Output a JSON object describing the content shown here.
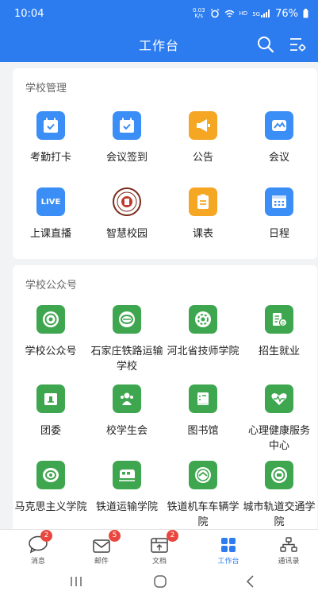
{
  "status": {
    "time": "10:04",
    "speed_value": "0.03",
    "speed_unit": "K/s",
    "hd": "HD",
    "signal": "5G",
    "battery": "76%"
  },
  "header": {
    "title": "工作台"
  },
  "school_management": {
    "title": "学校管理",
    "apps": [
      {
        "label": "考勤打卡",
        "icon": "calendar-check-icon"
      },
      {
        "label": "会议签到",
        "icon": "calendar-check-icon"
      },
      {
        "label": "公告",
        "icon": "megaphone-icon"
      },
      {
        "label": "会议",
        "icon": "meeting-icon"
      },
      {
        "label": "上课直播",
        "icon": "live-icon",
        "icon_text": "LIVE"
      },
      {
        "label": "智慧校园",
        "icon": "school-emblem-icon"
      },
      {
        "label": "课表",
        "icon": "schedule-icon"
      },
      {
        "label": "日程",
        "icon": "calendar-icon"
      }
    ]
  },
  "public_accounts": {
    "title": "学校公众号",
    "apps": [
      {
        "label": "学校公众号",
        "icon": "school-emblem-icon"
      },
      {
        "label": "石家庄铁路运输学校",
        "icon": "school-emblem-icon"
      },
      {
        "label": "河北省技师学院",
        "icon": "school-emblem-icon"
      },
      {
        "label": "招生就业",
        "icon": "enrollment-icon"
      },
      {
        "label": "团委",
        "icon": "league-icon"
      },
      {
        "label": "校学生会",
        "icon": "student-union-icon"
      },
      {
        "label": "图书馆",
        "icon": "library-icon"
      },
      {
        "label": "心理健康服务中心",
        "icon": "mental-health-icon"
      },
      {
        "label": "马克思主义学院",
        "icon": "school-emblem-icon"
      },
      {
        "label": "铁道运输学院",
        "icon": "train-icon"
      },
      {
        "label": "铁道机车车辆学院",
        "icon": "school-emblem-icon"
      },
      {
        "label": "城市轨道交通学院",
        "icon": "school-emblem-icon"
      }
    ]
  },
  "tabbar": {
    "items": [
      {
        "label": "消息",
        "badge": "2",
        "icon": "chat-bubble-icon"
      },
      {
        "label": "邮件",
        "badge": "5",
        "icon": "mail-icon"
      },
      {
        "label": "文档",
        "badge": "2",
        "icon": "document-icon"
      },
      {
        "label": "工作台",
        "badge": "",
        "icon": "grid-icon",
        "active": true
      },
      {
        "label": "通讯录",
        "badge": "",
        "icon": "contacts-icon"
      }
    ]
  },
  "colors": {
    "primary": "#2c7cf0",
    "blue_icon": "#3a8ef6",
    "orange_icon": "#f5a623",
    "green_icon": "#3fa650",
    "badge": "#e8463e"
  }
}
